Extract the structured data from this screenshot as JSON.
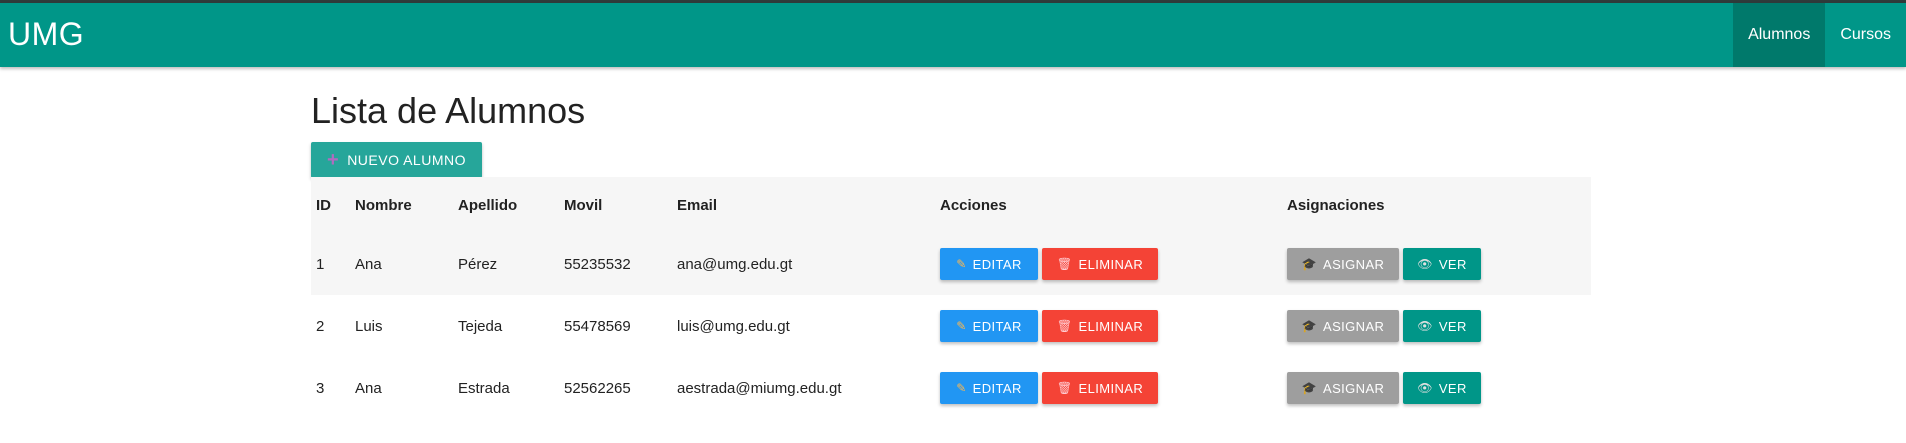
{
  "navbar": {
    "brand": "UMG",
    "links": [
      {
        "label": "Alumnos",
        "active": true
      },
      {
        "label": "Cursos",
        "active": false
      }
    ],
    "color": "#009688",
    "active_color": "#00796b"
  },
  "page": {
    "title": "Lista de Alumnos",
    "new_button": "NUEVO ALUMNO"
  },
  "table": {
    "headers": [
      "ID",
      "Nombre",
      "Apellido",
      "Movil",
      "Email",
      "Acciones",
      "Asignaciones"
    ],
    "rows": [
      {
        "id": "1",
        "nombre": "Ana",
        "apellido": "Pérez",
        "movil": "55235532",
        "email": "ana@umg.edu.gt"
      },
      {
        "id": "2",
        "nombre": "Luis",
        "apellido": "Tejeda",
        "movil": "55478569",
        "email": "luis@umg.edu.gt"
      },
      {
        "id": "3",
        "nombre": "Ana",
        "apellido": "Estrada",
        "movil": "52562265",
        "email": "aestrada@miumg.edu.gt"
      }
    ]
  },
  "actions": {
    "edit": "EDITAR",
    "delete": "ELIMINAR",
    "assign": "ASIGNAR",
    "view": "VER"
  },
  "icons": {
    "new": "plus-icon",
    "edit": "pencil-icon",
    "delete": "trash-icon",
    "assign": "graduation-cap-icon",
    "view": "eye-icon"
  },
  "colors": {
    "edit": "#2196f3",
    "delete": "#f44336",
    "assign": "#9e9e9e",
    "view": "#009688",
    "new": "#26a69a"
  }
}
